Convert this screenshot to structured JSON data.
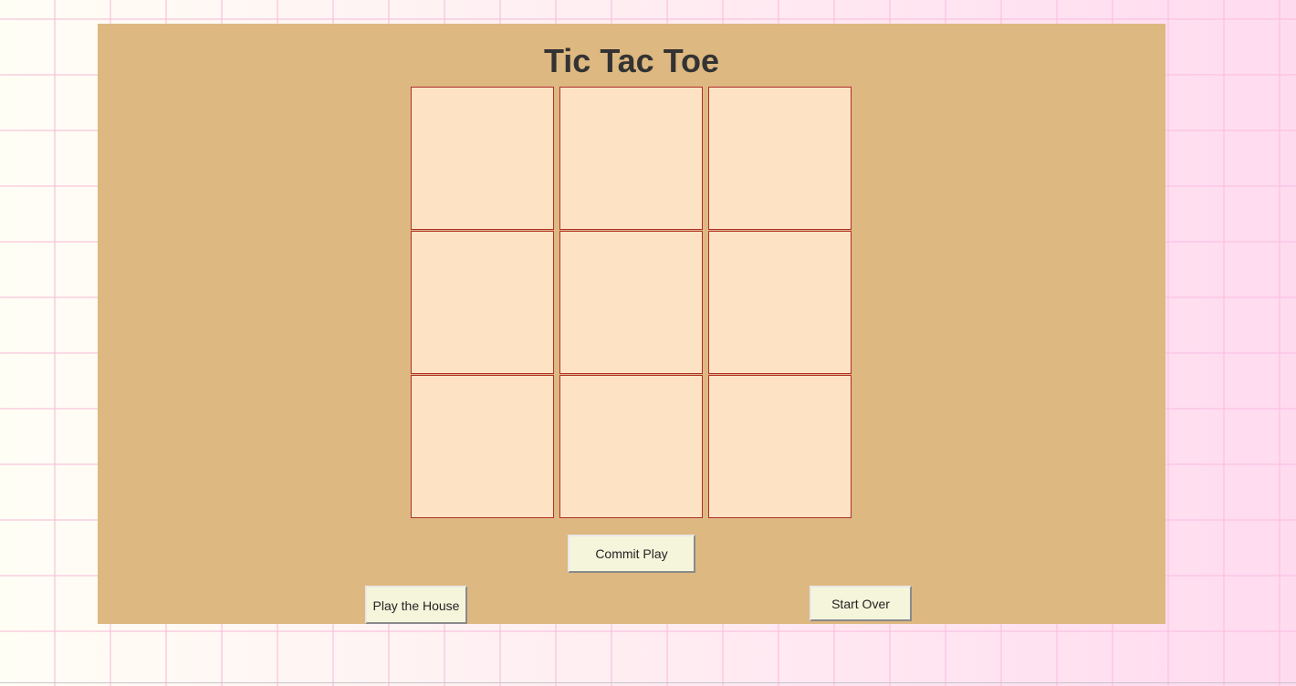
{
  "title": "Tic Tac Toe",
  "board": {
    "cells": [
      "",
      "",
      "",
      "",
      "",
      "",
      "",
      "",
      ""
    ]
  },
  "buttons": {
    "commit_play": "Commit Play",
    "play_the_house": "Play the House",
    "start_over": "Start Over"
  },
  "colors": {
    "page_background": "#fffef5",
    "grid_lines": "#f5bed7",
    "panel": "#deb881",
    "cell_fill": "#fde3c4",
    "cell_border": "#b0302a",
    "button_fill": "#f5f5dc",
    "title_text": "#333333"
  }
}
